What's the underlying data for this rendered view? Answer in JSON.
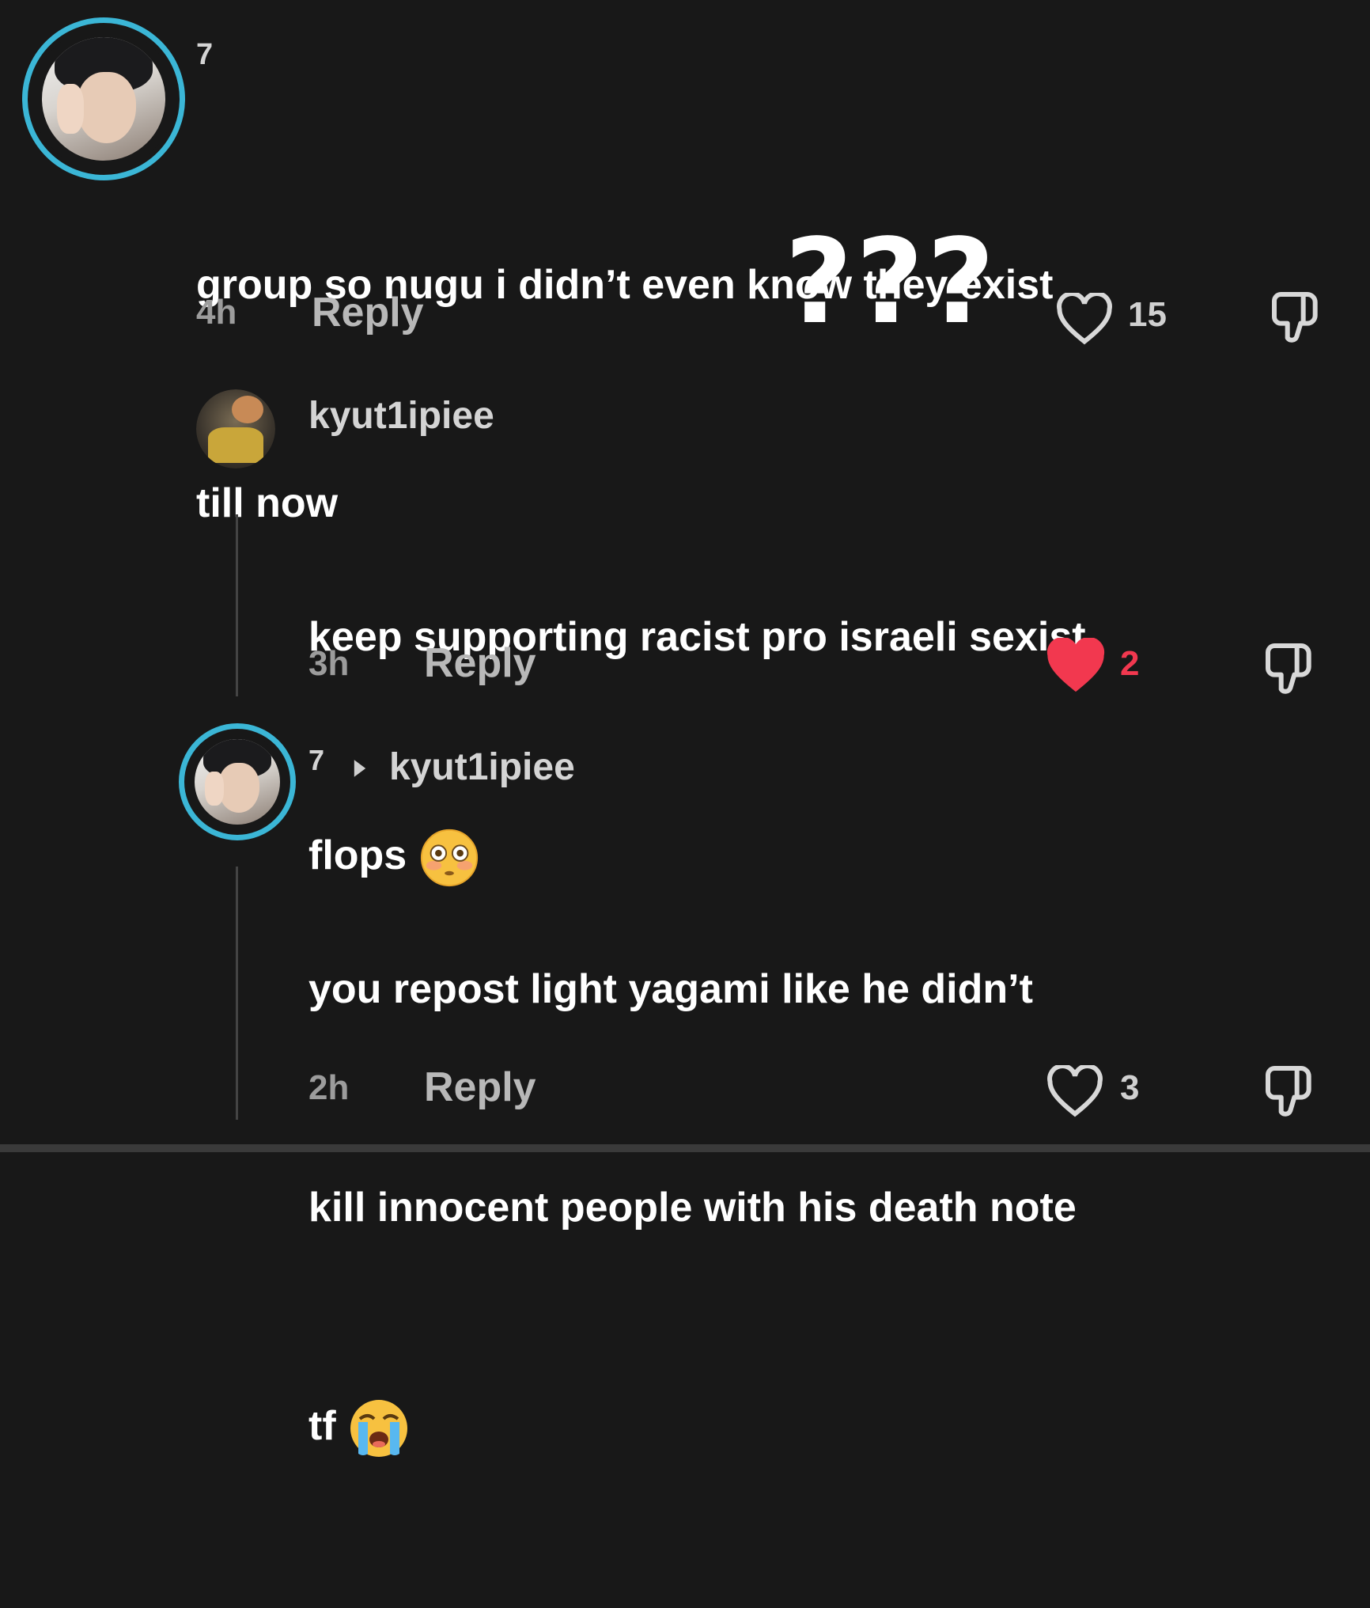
{
  "overlay": {
    "text": "???"
  },
  "comments": [
    {
      "username": "7",
      "lines": [
        "group so nugu i didn’t even know they exist",
        "till now"
      ],
      "time": "4h",
      "reply_label": "Reply",
      "likes": "15",
      "liked": false
    },
    {
      "username": "kyut1ipiee",
      "lines": [
        "keep supporting racist pro israeli sexist",
        "flops"
      ],
      "emoji": "flushed-face-emoji",
      "time": "3h",
      "reply_label": "Reply",
      "likes": "2",
      "liked": true
    },
    {
      "username": "7",
      "reply_to": "kyut1ipiee",
      "lines": [
        "you repost light yagami like he didn’t",
        "kill innocent people with his death note",
        "tf"
      ],
      "emoji": "crying-face-emoji",
      "time": "2h",
      "reply_label": "Reply",
      "likes": "3",
      "liked": false
    }
  ],
  "colors": {
    "background": "#181818",
    "avatar_ring": "#3bb6d6",
    "liked_heart": "#f2384f",
    "text": "#ffffff",
    "muted": "#9c9c9c"
  },
  "icons": {
    "like": "heart-icon",
    "dislike": "thumbs-down-icon",
    "reply_arrow": "triangle-right-icon"
  }
}
